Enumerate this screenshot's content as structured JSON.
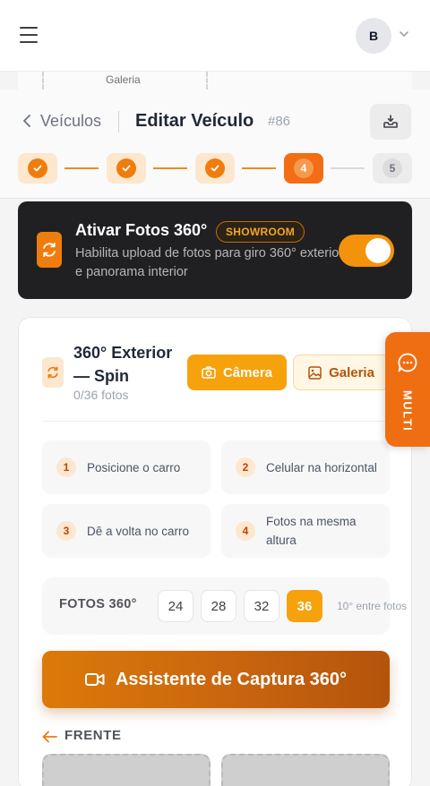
{
  "app_header": {
    "avatar_initial": "B",
    "icons": [
      "hamburger-menu-icon",
      "chevron-down-icon"
    ]
  },
  "background": {
    "galeria_label": "Galeria"
  },
  "page_header": {
    "back_label": "Veículos",
    "title": "Editar Veículo",
    "vehicle_id": "#86",
    "download_icon": "download-tray-icon"
  },
  "stepper": {
    "steps": [
      {
        "state": "done"
      },
      {
        "state": "done"
      },
      {
        "state": "done"
      },
      {
        "state": "active",
        "label": "4"
      },
      {
        "state": "todo",
        "label": "5"
      }
    ],
    "current_step": 4,
    "total_steps": 5
  },
  "feature_banner": {
    "title": "Ativar Fotos 360°",
    "badge": "SHOWROOM",
    "description": "Habilita upload de fotos para giro 360° exterior e panorama interior",
    "enabled": true
  },
  "spin_section": {
    "title": "360° Exterior — Spin",
    "count_text": "0/36 fotos",
    "camera_button": "Câmera",
    "gallery_button": "Galeria",
    "tips": [
      {
        "number": "1",
        "text": "Posicione o carro"
      },
      {
        "number": "2",
        "text": "Celular na horizontal"
      },
      {
        "number": "3",
        "text": "Dê a volta no carro"
      },
      {
        "number": "4",
        "text": "Fotos na mesma altura"
      }
    ],
    "photo_count": {
      "label": "FOTOS 360°",
      "options": [
        "24",
        "28",
        "32",
        "36"
      ],
      "selected": "36",
      "hint": "10° entre fotos"
    },
    "assistant_button": "Assistente de Captura 360°",
    "direction_label": "FRENTE"
  },
  "floating_tab": {
    "label": "MULTI",
    "icon": "chat-bubble-icon"
  },
  "colors": {
    "accent_orange": "#ef7d0e",
    "amber_button": "#f6a20c",
    "banner_dark": "#202022",
    "tab_orange": "#f06e12"
  }
}
